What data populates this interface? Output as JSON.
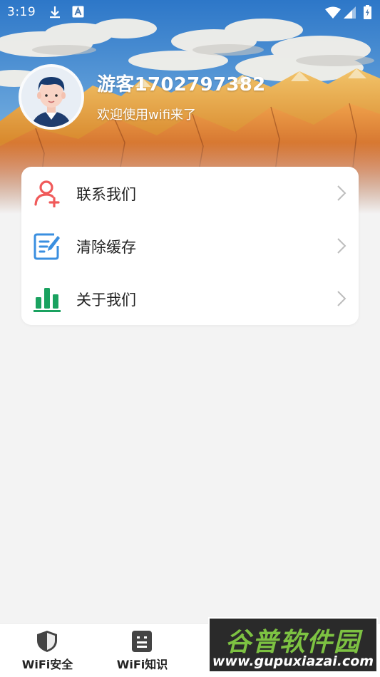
{
  "status_bar": {
    "time": "3:19",
    "icons": [
      "download-icon",
      "accessibility-a-icon",
      "wifi-icon",
      "cellular-signal-icon",
      "battery-charging-icon"
    ]
  },
  "profile": {
    "username": "游客1702797382",
    "welcome": "欢迎使用wifi来了",
    "avatar_icon": "user-avatar-icon"
  },
  "menu": {
    "items": [
      {
        "label": "联系我们",
        "icon": "add-contact-icon",
        "color": "#f05a5a"
      },
      {
        "label": "清除缓存",
        "icon": "edit-document-icon",
        "color": "#3a8fe0"
      },
      {
        "label": "关于我们",
        "icon": "bar-chart-icon",
        "color": "#1aa260"
      }
    ],
    "chevron_icon": "chevron-right-icon"
  },
  "bottom_nav": {
    "items": [
      {
        "label": "WiFi安全",
        "icon": "shield-icon"
      },
      {
        "label": "WiFi知识",
        "icon": "note-icon"
      }
    ]
  },
  "watermark": {
    "title": "谷普软件园",
    "url": "www.gupuxiazai.com"
  },
  "colors": {
    "page_background": "#f3f3f3",
    "card_background": "#ffffff",
    "text_primary": "#222222",
    "chevron": "#bdbdbd"
  }
}
